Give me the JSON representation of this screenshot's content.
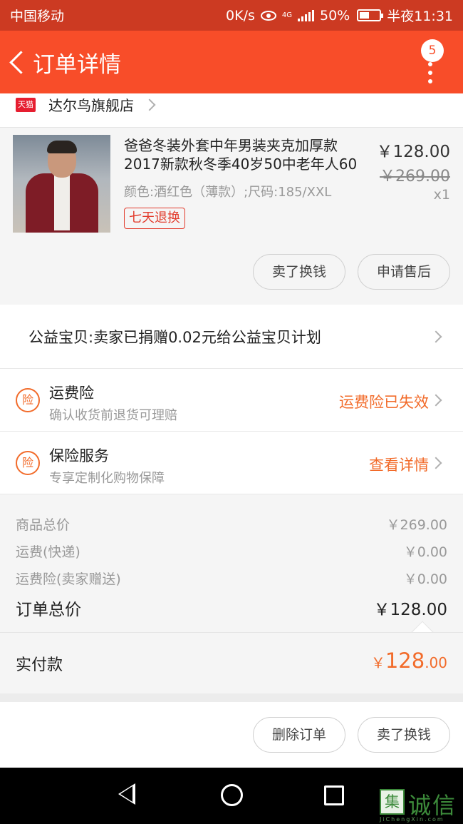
{
  "status_bar": {
    "carrier": "中国移动",
    "speed": "0K/s",
    "network": "4G",
    "battery": "50%",
    "battery_level": 0.5,
    "time": "半夜11:31"
  },
  "header": {
    "title": "订单详情",
    "badge_count": "5"
  },
  "shop": {
    "badge": "天猫",
    "name": "达尔鸟旗舰店"
  },
  "item": {
    "title": "爸爸冬装外套中年男装夹克加厚款2017新款秋冬季40岁50中老年人60",
    "sku": "颜色:酒红色（薄款）;尺码:185/XXL",
    "return_policy": "七天退换",
    "price": "￥128.00",
    "original_price": "￥269.00",
    "quantity": "x1",
    "actions": {
      "sell": "卖了换钱",
      "after_sale": "申请售后"
    }
  },
  "charity": {
    "text": "公益宝贝:卖家已捐赠0.02元给公益宝贝计划"
  },
  "insurance": [
    {
      "icon": "险",
      "title": "运费险",
      "subtitle": "确认收货前退货可理赔",
      "status": "运费险已失效"
    },
    {
      "icon": "险",
      "title": "保险服务",
      "subtitle": "专享定制化购物保障",
      "status": "查看详情"
    }
  ],
  "summary": {
    "goods_total_label": "商品总价",
    "goods_total": "￥269.00",
    "shipping_label": "运费(快递)",
    "shipping": "￥0.00",
    "shipping_ins_label": "运费险(卖家赠送)",
    "shipping_ins": "￥0.00",
    "order_total_label": "订单总价",
    "order_total": "￥128.00"
  },
  "payment": {
    "label": "实付款",
    "symbol": "￥",
    "integer": "128",
    "decimal": ".00"
  },
  "bottom_actions": {
    "delete": "删除订单",
    "sell": "卖了换钱"
  },
  "watermark": {
    "logo": "集",
    "text": "诚信",
    "url": "JiChengXin.com"
  },
  "colors": {
    "header": "#f84d29",
    "status_bar": "#cc3a22",
    "accent": "#f26b2a"
  }
}
